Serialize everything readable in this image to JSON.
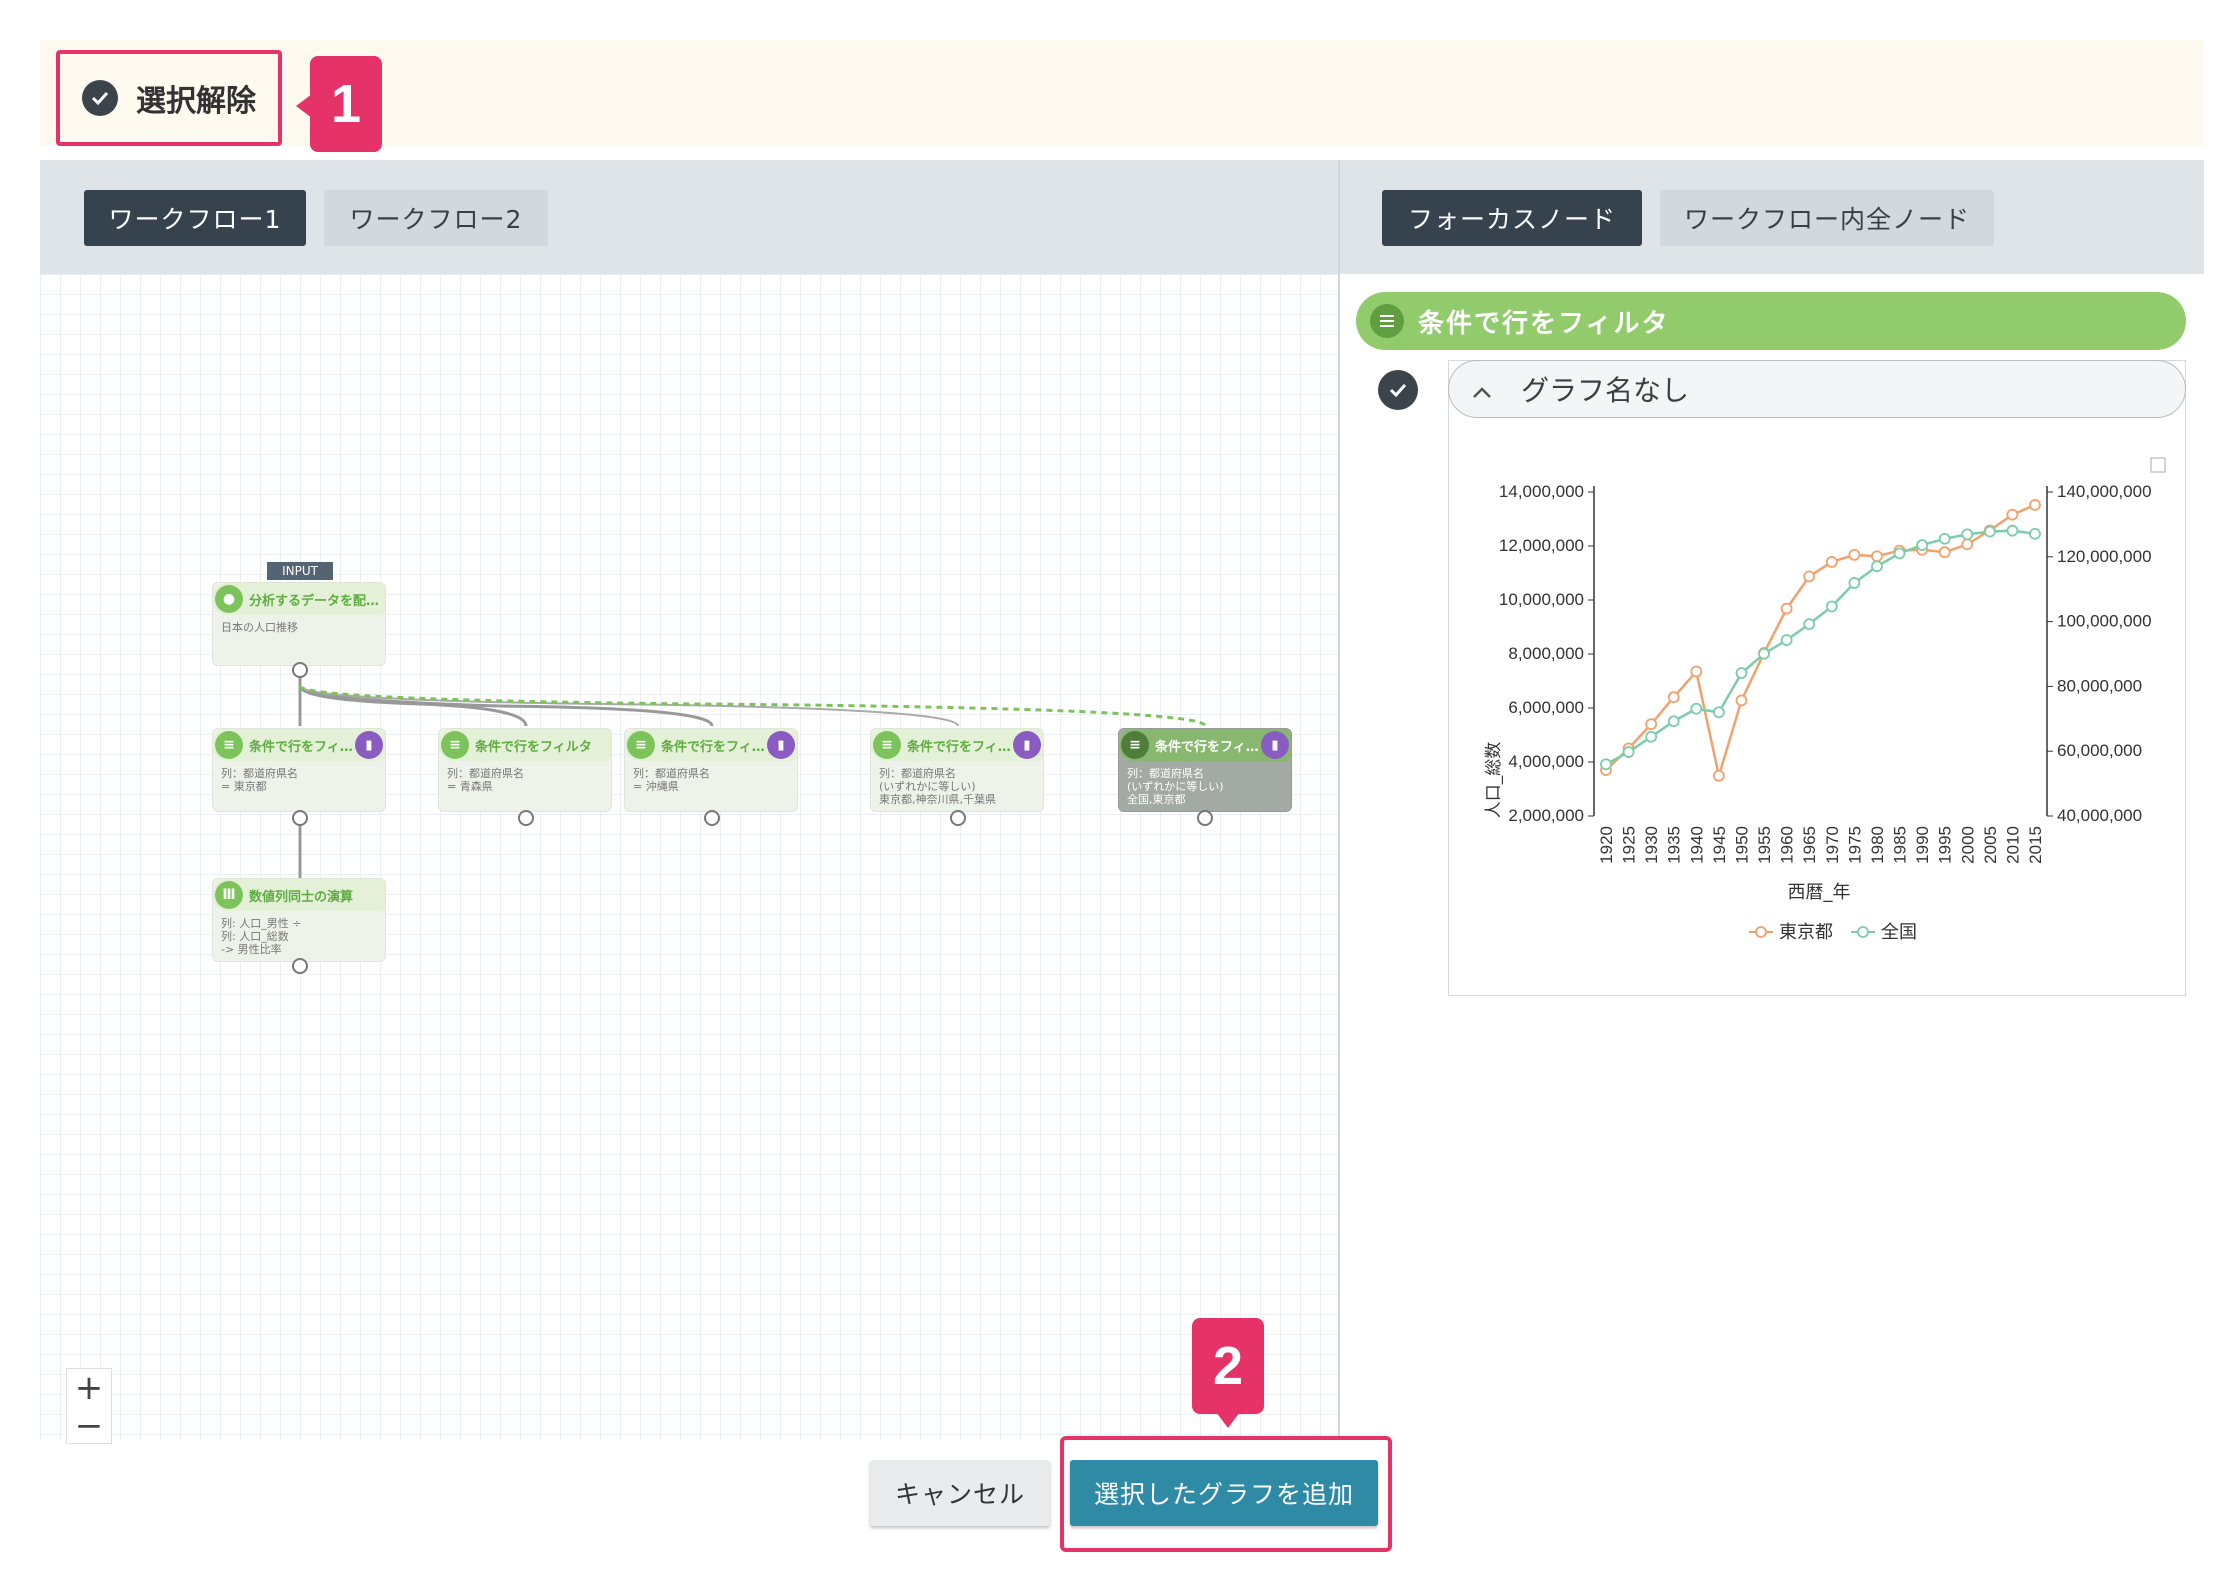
{
  "topbar": {
    "deselect_label": "選択解除"
  },
  "annotations": {
    "badge1": "1",
    "badge2": "2"
  },
  "workflow_tabs": [
    {
      "label": "ワークフロー1",
      "active": true
    },
    {
      "label": "ワークフロー2",
      "active": false
    }
  ],
  "node_tabs": [
    {
      "label": "フォーカスノード",
      "active": true
    },
    {
      "label": "ワークフロー内全ノード",
      "active": false
    }
  ],
  "canvas": {
    "input_tag": "INPUT",
    "nodes": [
      {
        "title": "分析するデータを配…",
        "body": "日本の人口推移",
        "icon": "database-icon"
      },
      {
        "title": "条件で行をフィ…",
        "body": "列：都道府県名\n= 東京都",
        "icon": "filter-icon",
        "graph": true
      },
      {
        "title": "条件で行をフィルタ",
        "body": "列：都道府県名\n= 青森県",
        "icon": "filter-icon"
      },
      {
        "title": "条件で行をフィ…",
        "body": "列：都道府県名\n= 沖縄県",
        "icon": "filter-icon",
        "graph": true
      },
      {
        "title": "条件で行をフィ…",
        "body": "列：都道府県名\n(いずれかに等しい)\n東京都,神奈川県,千葉県",
        "icon": "filter-icon",
        "graph": true
      },
      {
        "title": "条件で行をフィ…",
        "body": "列：都道府県名\n(いずれかに等しい)\n全国,東京都",
        "icon": "filter-icon",
        "graph": true,
        "selected": true
      },
      {
        "title": "数値列同士の演算",
        "body": "列: 人口_男性 ÷\n列: 人口_総数\n-> 男性比率",
        "icon": "columns-icon"
      }
    ],
    "zoom_in": "+",
    "zoom_out": "−"
  },
  "focus": {
    "node_title": "条件で行をフィルタ",
    "graph_title": "グラフ名なし"
  },
  "chart_data": {
    "type": "line",
    "x": [
      1920,
      1925,
      1930,
      1935,
      1940,
      1945,
      1950,
      1955,
      1960,
      1965,
      1970,
      1975,
      1980,
      1985,
      1990,
      1995,
      2000,
      2005,
      2010,
      2015
    ],
    "xlabel": "西暦_年",
    "ylabel": "人口_総数",
    "ylim_left": [
      2000000,
      14000000
    ],
    "ylim_right": [
      40000000,
      140000000
    ],
    "left_ticks": [
      "2,000,000",
      "4,000,000",
      "6,000,000",
      "8,000,000",
      "10,000,000",
      "12,000,000",
      "14,000,000"
    ],
    "right_ticks": [
      "40,000,000",
      "60,000,000",
      "80,000,000",
      "100,000,000",
      "120,000,000",
      "140,000,000"
    ],
    "series": [
      {
        "name": "東京都",
        "axis": "left",
        "color": "#f0a26d",
        "values": [
          3700000,
          4500000,
          5400000,
          6400000,
          7350000,
          3490000,
          6280000,
          8040000,
          9680000,
          10870000,
          11410000,
          11670000,
          11620000,
          11830000,
          11860000,
          11770000,
          12060000,
          12580000,
          13160000,
          13520000
        ]
      },
      {
        "name": "全国",
        "axis": "right",
        "color": "#7cccaa",
        "values": [
          55960000,
          59740000,
          64450000,
          69250000,
          73110000,
          71998000,
          84110000,
          90080000,
          94300000,
          99210000,
          104670000,
          111940000,
          117060000,
          121050000,
          123610000,
          125570000,
          126930000,
          127770000,
          128060000,
          127090000
        ]
      }
    ],
    "legend": "bottom"
  },
  "footer": {
    "cancel_label": "キャンセル",
    "add_label": "選択したグラフを追加"
  },
  "colors": {
    "accent": "#e5336a",
    "primary_button": "#2f8aa6",
    "dark_tab": "#36434f",
    "node_green": "#92cb6b",
    "graph_purple": "#8a5cc1"
  }
}
